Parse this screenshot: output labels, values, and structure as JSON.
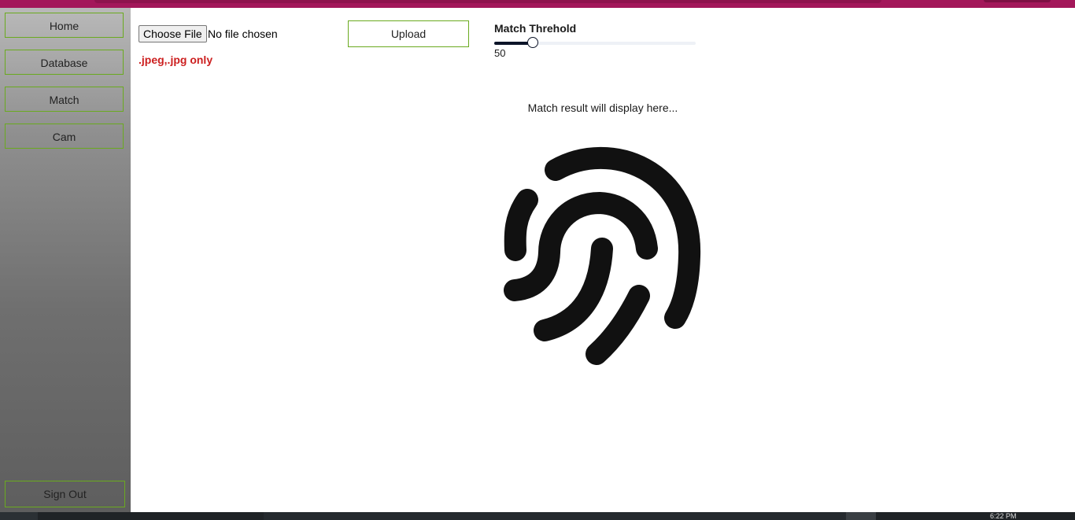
{
  "sidebar": {
    "items": [
      {
        "label": "Home"
      },
      {
        "label": "Database"
      },
      {
        "label": "Match"
      },
      {
        "label": "Cam"
      }
    ],
    "signout_label": "Sign Out"
  },
  "upload": {
    "choose_file_label": "Choose File",
    "file_status": "No file chosen",
    "hint": ".jpeg,.jpg only",
    "upload_label": "Upload"
  },
  "threshold": {
    "label": "Match Threhold",
    "value": "50",
    "fraction": 0.19
  },
  "result": {
    "placeholder": "Match result will display here..."
  },
  "taskbar": {
    "clock": "6:22 PM"
  },
  "colors": {
    "accent_border": "#6aaa1f",
    "hint_red": "#cc1f1f",
    "topbar": "#a3175a"
  },
  "icons": {
    "result": "fingerprint-icon"
  }
}
